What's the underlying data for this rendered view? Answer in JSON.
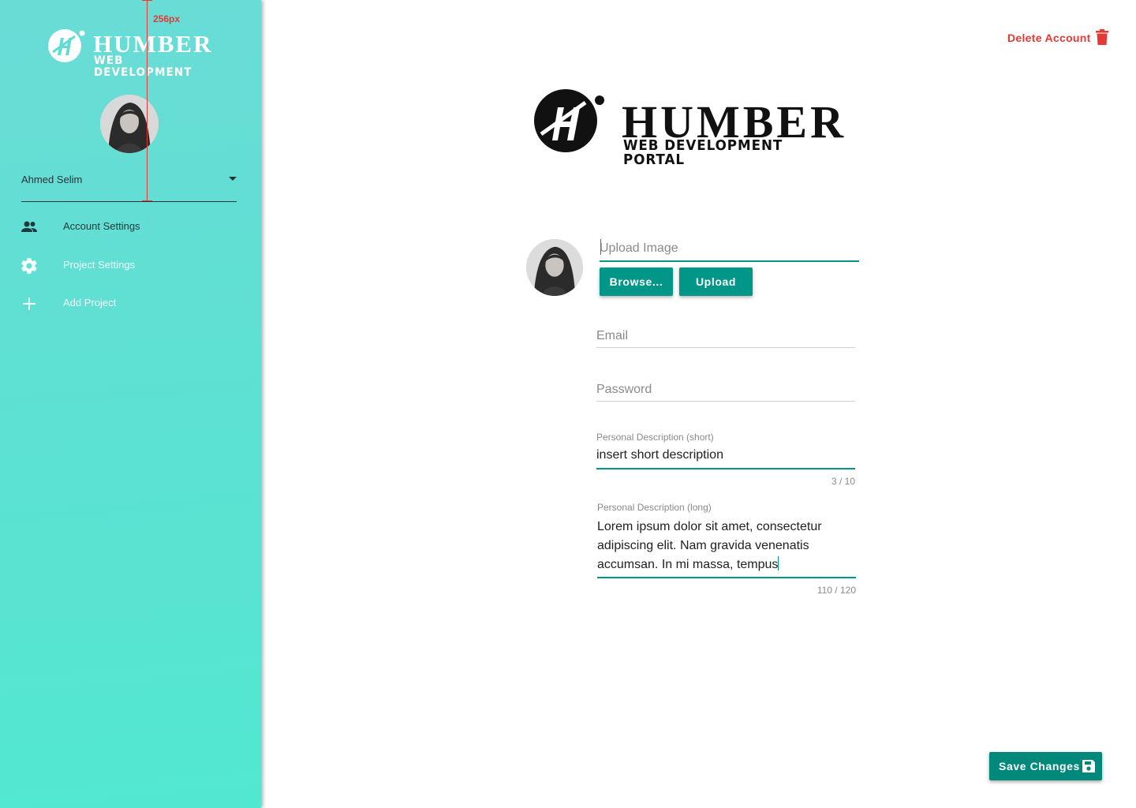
{
  "colors": {
    "accent": "#009688",
    "sidebar_gradient_start": "#6adcd6",
    "sidebar_gradient_end": "#52e8d0",
    "danger": "#e53935",
    "guide": "#e53935"
  },
  "sidebar": {
    "logo": {
      "title": "HUMBER",
      "subtitle": "WEB DEVELOPMENT",
      "icon": "humber-h-logo-icon"
    },
    "guide_label": "256px",
    "user": {
      "name": "Ahmed Selim"
    },
    "nav": [
      {
        "label": "Account Settings",
        "icon": "people-icon",
        "active": true
      },
      {
        "label": "Project Settings",
        "icon": "gear-icon",
        "active": false
      },
      {
        "label": "Add Project",
        "icon": "plus-icon",
        "active": false
      }
    ]
  },
  "header": {
    "delete_label": "Delete Account",
    "delete_icon": "trash-icon"
  },
  "main_logo": {
    "title": "HUMBER",
    "subtitle": "WEB DEVELOPMENT PORTAL"
  },
  "form": {
    "upload_placeholder": "Upload Image",
    "browse_label": "Browse...",
    "upload_label": "Upload",
    "email_placeholder": "Email",
    "password_placeholder": "Password",
    "short_desc": {
      "label": "Personal Description (short)",
      "value": "insert short description",
      "counter": "3 / 10"
    },
    "long_desc": {
      "label": "Personal Description (long)",
      "value": "Lorem ipsum dolor sit amet, consectetur adipiscing elit. Nam gravida venenatis accumsan. In mi massa, tempus",
      "counter": "110 / 120"
    }
  },
  "footer": {
    "save_label": "Save Changes",
    "save_icon": "floppy-disk-icon"
  }
}
